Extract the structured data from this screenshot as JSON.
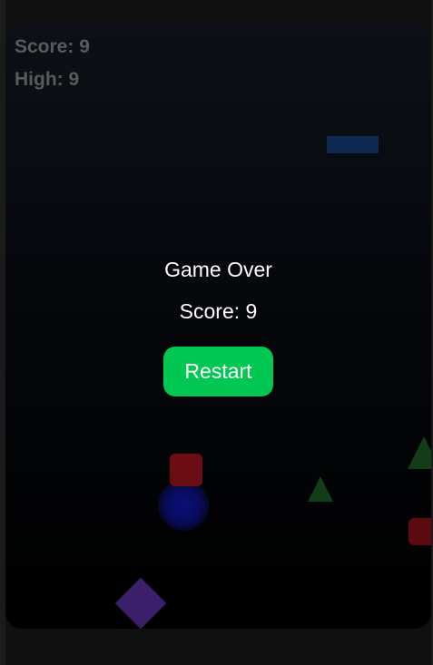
{
  "hud": {
    "score_text": "Score: 9",
    "high_text": "High: 9"
  },
  "game_over": {
    "title": "Game Over",
    "score_text": "Score: 9",
    "restart_label": "Restart"
  },
  "colors": {
    "hud_text": "#5a5a5a",
    "restart_button": "#00c853",
    "obstacle_red": "#6b0d12",
    "obstacle_green": "#113d18",
    "obstacle_blue": "#0f2a52",
    "obstacle_purple": "#3b1f6b",
    "player": "#0b0f7a"
  },
  "sprites": [
    {
      "name": "blue-bar",
      "shape": "rectangle"
    },
    {
      "name": "red-square",
      "shape": "rounded-square"
    },
    {
      "name": "red-square",
      "shape": "rounded-square"
    },
    {
      "name": "player-orb",
      "shape": "glowing-circle"
    },
    {
      "name": "purple-diamond",
      "shape": "diamond"
    },
    {
      "name": "green-triangle",
      "shape": "triangle"
    },
    {
      "name": "green-triangle",
      "shape": "triangle"
    }
  ]
}
